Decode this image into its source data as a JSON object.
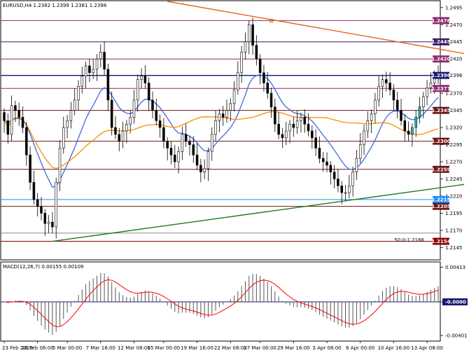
{
  "chart_data": {
    "type": "candlestick",
    "main_panel": {
      "title": "EURUSD,H4  1.2382 1.2399 1.2381 1.2398",
      "current_price": 1.2396,
      "y_range": [
        1.2128,
        1.2504
      ],
      "y_ticks": [
        "1.2495",
        "1.2470",
        "1.2445",
        "1.2420",
        "1.2396",
        "1.2370",
        "1.2345",
        "1.2320",
        "1.2295",
        "1.2270",
        "1.2245",
        "1.2220",
        "1.2195",
        "1.2170",
        "1.2145"
      ],
      "horizontal_levels": [
        {
          "label": "1.2476",
          "value": 1.2476,
          "color": "#8b2a6e"
        },
        {
          "label": "1.2445",
          "value": 1.2445,
          "color": "#3a1e64"
        },
        {
          "label": "1.2420",
          "value": 1.242,
          "color": "#8b2a6e"
        },
        {
          "label": "1.2396",
          "value": 1.2396,
          "color": "#191970"
        },
        {
          "label": "1.2377",
          "value": 1.2377,
          "color": "#8b2a6e"
        },
        {
          "label": "1.2345",
          "value": 1.2345,
          "color": "#6b1414"
        },
        {
          "label": "1.2300",
          "value": 1.23,
          "color": "#6b1414"
        },
        {
          "label": "1.2259",
          "value": 1.2259,
          "color": "#6b1414"
        },
        {
          "label": "1.2215",
          "value": 1.2215,
          "color": "#1e90ff"
        },
        {
          "label": "1.2205",
          "value": 1.2205,
          "color": "#6b1414"
        },
        {
          "label": "1.2154",
          "value": 1.2154,
          "color": "#8b0000"
        }
      ],
      "fib_label": "50.0-1.2166",
      "fib_value": 1.2166,
      "trendlines": [
        {
          "name": "resistance",
          "color": "#e8641e",
          "from_bar": 44,
          "from_value": 1.2504,
          "to_bar": 124,
          "to_value": 1.2428
        },
        {
          "name": "support",
          "color": "#1e7d1e",
          "from_bar": 13,
          "from_value": 1.2154,
          "to_bar": 124,
          "to_value": 1.2237
        }
      ],
      "ma_fast_color": "#4169e1",
      "ma_slow_color": "#ff8c00",
      "candle_colors": {
        "up": "#000000",
        "down": "#000000",
        "up_fill": "#ffffff",
        "down_fill": "#000000"
      },
      "highlight_color": "#20c0c0"
    },
    "macd_panel": {
      "title": "MACD(12,26,7) 0.00155 0.00109",
      "y_ticks": [
        "0.00413",
        "-0.0000",
        "-0.00401"
      ],
      "y_range": [
        -0.0046,
        0.0046
      ],
      "signal_color": "#ff0000",
      "zero_line_color": "#191970"
    },
    "x_labels": [
      {
        "text": "23 Feb 2018",
        "bar": 0
      },
      {
        "text": "28 Feb 08:00",
        "bar": 9
      },
      {
        "text": "5 Mar 00:00",
        "bar": 17
      },
      {
        "text": "7 Mar 16:00",
        "bar": 26
      },
      {
        "text": "12 Mar 08:00",
        "bar": 35
      },
      {
        "text": "15 Mar 00:00",
        "bar": 43
      },
      {
        "text": "19 Mar 16:00",
        "bar": 52
      },
      {
        "text": "22 Mar 08:00",
        "bar": 61
      },
      {
        "text": "27 Mar 00:00",
        "bar": 69
      },
      {
        "text": "29 Mar 16:00",
        "bar": 78
      },
      {
        "text": "3 Apr 08:00",
        "bar": 87
      },
      {
        "text": "6 Apr 00:00",
        "bar": 96
      },
      {
        "text": "10 Apr 16:00",
        "bar": 105
      },
      {
        "text": "13 Apr 08:00",
        "bar": 114
      }
    ],
    "closes": [
      1.233,
      1.231,
      1.2352,
      1.2345,
      1.2335,
      1.232,
      1.228,
      1.224,
      1.2215,
      1.2205,
      1.2195,
      1.218,
      1.2182,
      1.2175,
      1.224,
      1.229,
      1.232,
      1.233,
      1.2345,
      1.236,
      1.238,
      1.2395,
      1.241,
      1.24,
      1.2405,
      1.242,
      1.243,
      1.2405,
      1.236,
      1.232,
      1.231,
      1.23,
      1.2315,
      1.2325,
      1.2335,
      1.236,
      1.239,
      1.2395,
      1.2385,
      1.236,
      1.2345,
      1.233,
      1.232,
      1.23,
      1.229,
      1.228,
      1.227,
      1.2285,
      1.231,
      1.23,
      1.2295,
      1.228,
      1.2265,
      1.2255,
      1.226,
      1.2285,
      1.231,
      1.233,
      1.234,
      1.2335,
      1.2345,
      1.2355,
      1.2375,
      1.24,
      1.243,
      1.2445,
      1.247,
      1.244,
      1.242,
      1.24,
      1.2385,
      1.237,
      1.235,
      1.2325,
      1.231,
      1.2305,
      1.2315,
      1.2325,
      1.232,
      1.233,
      1.2335,
      1.2325,
      1.2315,
      1.2305,
      1.229,
      1.2275,
      1.227,
      1.2265,
      1.2255,
      1.2245,
      1.2235,
      1.2225,
      1.2225,
      1.2235,
      1.2255,
      1.2275,
      1.2295,
      1.2315,
      1.233,
      1.234,
      1.236,
      1.238,
      1.239,
      1.2385,
      1.2375,
      1.236,
      1.2345,
      1.233,
      1.2315,
      1.231,
      1.232,
      1.2335,
      1.235,
      1.2365,
      1.2378,
      1.2385,
      1.2395,
      1.2398
    ]
  }
}
